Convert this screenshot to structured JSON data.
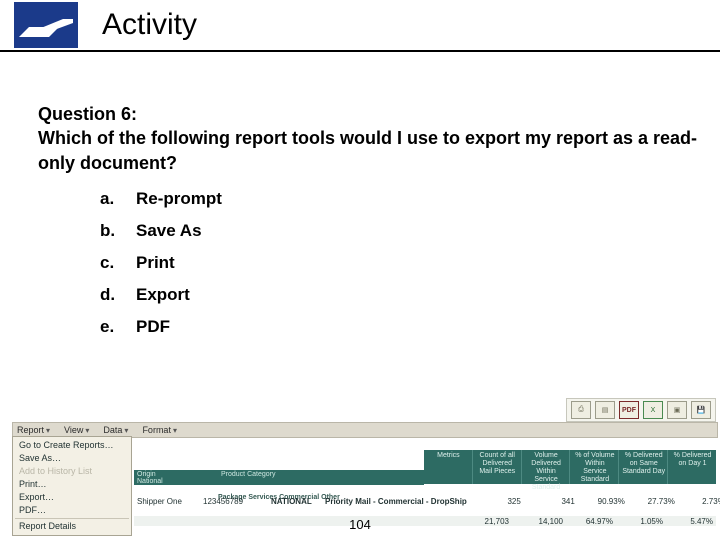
{
  "header": {
    "title": "Activity"
  },
  "question": {
    "label": "Question 6:",
    "text": "Which of the following report tools would I use to export my report as a read-only document?"
  },
  "options": [
    {
      "letter": "a.",
      "text": "Re-prompt"
    },
    {
      "letter": "b.",
      "text": "Save As"
    },
    {
      "letter": "c.",
      "text": "Print"
    },
    {
      "letter": "d.",
      "text": "Export"
    },
    {
      "letter": "e.",
      "text": "PDF"
    }
  ],
  "toolbar": {
    "icons": [
      "print-icon",
      "pagesetup-icon",
      "pdf-icon",
      "excel-icon",
      "fullscreen-icon",
      "save-icon"
    ],
    "iconLabels": [
      "⎙",
      "▤",
      "PDF",
      "X",
      "▣",
      "💾"
    ],
    "menus": [
      "Report",
      "View",
      "Data",
      "Format"
    ]
  },
  "dropdown": [
    "Go to Create Reports…",
    "Save As…",
    "Add to History List",
    "Print…",
    "Export…",
    "PDF…",
    "---",
    "Report Details"
  ],
  "table": {
    "metricsHeaders": [
      "Metrics",
      "Count of all Delivered Mail Pieces",
      "Volume Delivered Within Service Standard",
      "% of Volume Within Service Standard",
      "% Delivered on Same Standard Day",
      "% Delivered on Day 1"
    ],
    "subHeaderLabels": {
      "origin": "Origin",
      "national": "National",
      "prodcat": "Product Category"
    },
    "subBand": "Package Services   Commercial   Other",
    "rows": [
      {
        "shipper": "Shipper One",
        "num": "123456789",
        "nat": "NATIONAL",
        "prod": "Priority Mail - Commercial - DropShip",
        "v1": "325",
        "v2": "341",
        "v3": "90.93%",
        "v4": "27.73%",
        "v5": "2.73%"
      },
      {
        "shipper": "",
        "num": "",
        "nat": "",
        "prod": "",
        "v1": "21,703",
        "v2": "14,100",
        "v3": "64.97%",
        "v4": "1.05%",
        "v5": "5.47%"
      }
    ]
  },
  "pageNumber": "104"
}
